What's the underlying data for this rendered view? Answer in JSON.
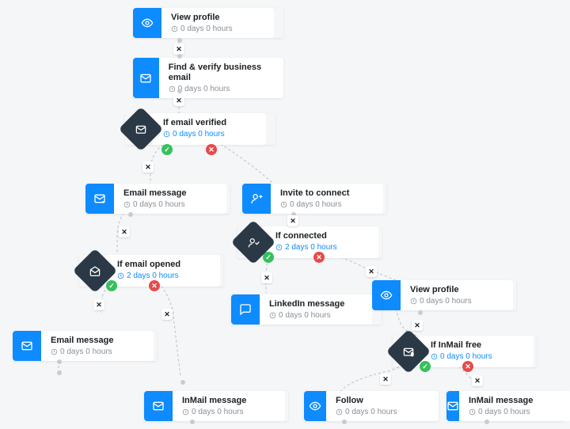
{
  "nodes": {
    "n1": {
      "title": "View profile",
      "delay": "0 days 0 hours",
      "type": "action",
      "icon": "eye"
    },
    "n2": {
      "title": "Find & verify business email",
      "delay": "0 days 0 hours",
      "type": "action",
      "icon": "mail"
    },
    "n3": {
      "title": "If email verified",
      "delay": "0 days 0 hours",
      "type": "cond",
      "icon": "mail"
    },
    "n4": {
      "title": "Email message",
      "delay": "0 days 0 hours",
      "type": "action",
      "icon": "mail-send"
    },
    "n5": {
      "title": "Invite to connect",
      "delay": "0 days 0 hours",
      "type": "action",
      "icon": "person-add"
    },
    "n6": {
      "title": "If connected",
      "delay": "2 days 0 hours",
      "type": "cond",
      "icon": "person-check"
    },
    "n7": {
      "title": "If email opened",
      "delay": "2 days 0 hours",
      "type": "cond",
      "icon": "mail-open"
    },
    "n8": {
      "title": "View profile",
      "delay": "0 days 0 hours",
      "type": "action",
      "icon": "eye"
    },
    "n9": {
      "title": "LinkedIn message",
      "delay": "0 days 0 hours",
      "type": "action",
      "icon": "chat"
    },
    "n10": {
      "title": "Email message",
      "delay": "0 days 0 hours",
      "type": "action",
      "icon": "mail-send"
    },
    "n11": {
      "title": "If InMail free",
      "delay": "0 days 0 hours",
      "type": "cond",
      "icon": "mail-cash"
    },
    "n12": {
      "title": "InMail message",
      "delay": "0 days 0 hours",
      "type": "action",
      "icon": "mail-send"
    },
    "n13": {
      "title": "Follow",
      "delay": "0 days 0 hours",
      "type": "action",
      "icon": "eye"
    },
    "n14": {
      "title": "InMail message",
      "delay": "0 days 0 hours",
      "type": "action",
      "icon": "mail-send"
    }
  },
  "colors": {
    "accent": "#0d8bff",
    "cond": "#2b3946",
    "yes": "#35c15c",
    "no": "#e54b4b"
  }
}
